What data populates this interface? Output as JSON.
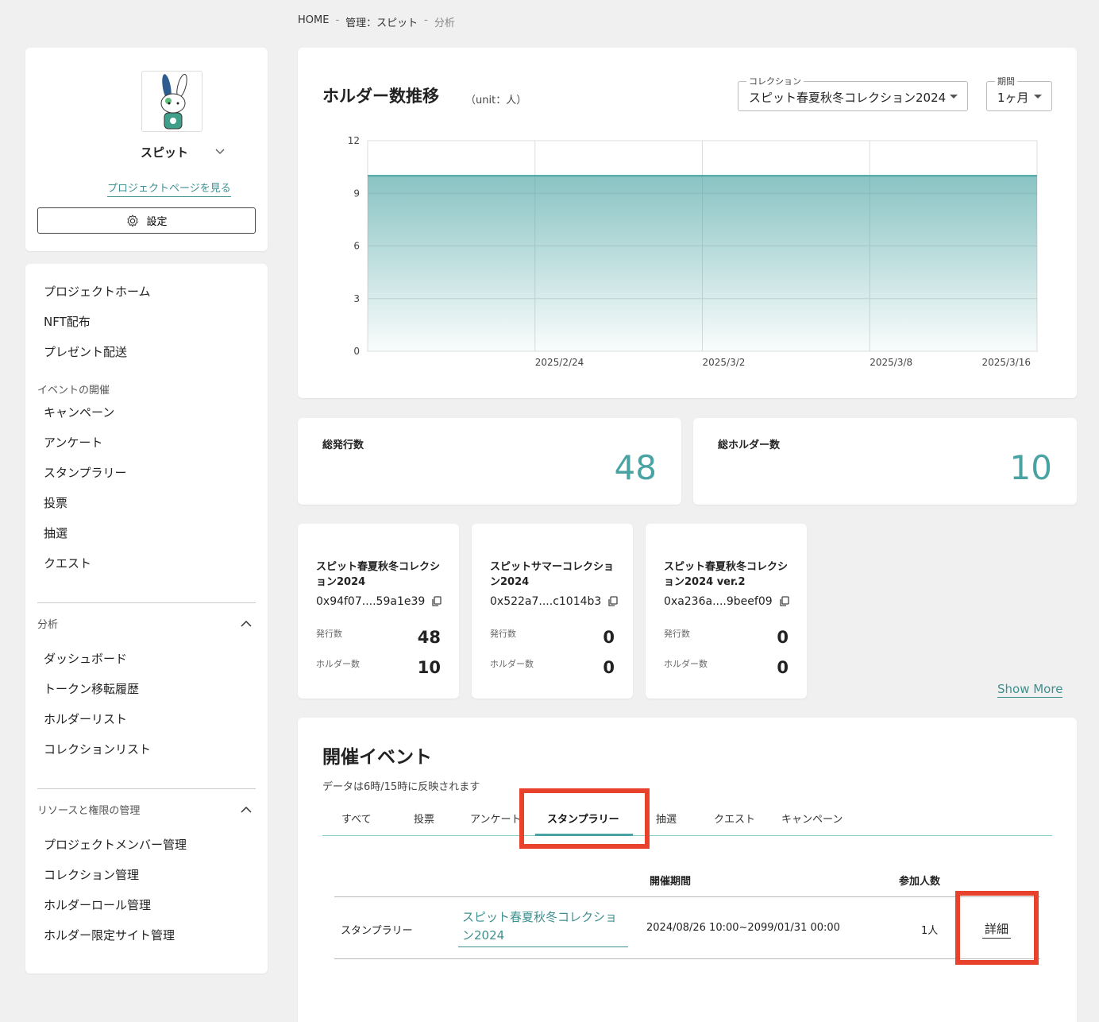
{
  "breadcrumb": {
    "home": "HOME",
    "sep": "-",
    "manage": "管理：スピット",
    "current": "分析"
  },
  "profile": {
    "name": "スピット",
    "project_link": "プロジェクトページを見る",
    "settings_label": "設定"
  },
  "nav": {
    "top_items": [
      "プロジェクトホーム",
      "NFT配布",
      "プレゼント配送"
    ],
    "event_section": "イベントの開催",
    "event_items": [
      "キャンペーン",
      "アンケート",
      "スタンプラリー",
      "投票",
      "抽選",
      "クエスト"
    ],
    "analysis_section": "分析",
    "analysis_items": [
      "ダッシュボード",
      "トークン移転履歴",
      "ホルダーリスト",
      "コレクションリスト"
    ],
    "resource_section": "リソースと権限の管理",
    "resource_items": [
      "プロジェクトメンバー管理",
      "コレクション管理",
      "ホルダーロール管理",
      "ホルダー限定サイト管理"
    ]
  },
  "chart": {
    "title": "ホルダー数推移",
    "unit": "（unit：人）",
    "collection_legend": "コレクション",
    "collection_value": "スピット春夏秋冬コレクション2024",
    "period_legend": "期間",
    "period_value": "1ヶ月",
    "accent": "#4aa3a3"
  },
  "chart_data": {
    "type": "area",
    "x": [
      "2025/2/18",
      "2025/2/24",
      "2025/3/2",
      "2025/3/8",
      "2025/3/16"
    ],
    "x_tick_labels": [
      "2025/2/24",
      "2025/3/2",
      "2025/3/8",
      "2025/3/16"
    ],
    "values": [
      10,
      10,
      10,
      10,
      10
    ],
    "y_ticks": [
      0,
      3,
      6,
      9,
      12
    ],
    "ylim": [
      0,
      12
    ],
    "grid": true
  },
  "stats": {
    "total_issued_label": "総発行数",
    "total_issued": "48",
    "total_holders_label": "総ホルダー数",
    "total_holders": "10"
  },
  "collections": [
    {
      "name": "スピット春夏秋冬コレクション2024",
      "address": "0x94f07....59a1e39",
      "issued_label": "発行数",
      "issued": "48",
      "holders_label": "ホルダー数",
      "holders": "10"
    },
    {
      "name": "スピットサマーコレクション2024",
      "address": "0x522a7....c1014b3",
      "issued_label": "発行数",
      "issued": "0",
      "holders_label": "ホルダー数",
      "holders": "0"
    },
    {
      "name": "スピット春夏秋冬コレクション2024 ver.2",
      "address": "0xa236a....9beef09",
      "issued_label": "発行数",
      "issued": "0",
      "holders_label": "ホルダー数",
      "holders": "0"
    }
  ],
  "show_more": "Show More",
  "events": {
    "title": "開催イベント",
    "note": "データは6時/15時に反映されます",
    "tabs": [
      "すべて",
      "投票",
      "アンケート",
      "スタンプラリー",
      "抽選",
      "クエスト",
      "キャンペーン"
    ],
    "active_tab": "スタンプラリー",
    "headers": {
      "period": "開催期間",
      "participants": "参加人数"
    },
    "rows": [
      {
        "type": "スタンプラリー",
        "name": "スピット春夏秋冬コレクション2024",
        "period": "2024/08/26 10:00~2099/01/31 00:00",
        "participants": "1人",
        "detail": "詳細"
      }
    ]
  }
}
